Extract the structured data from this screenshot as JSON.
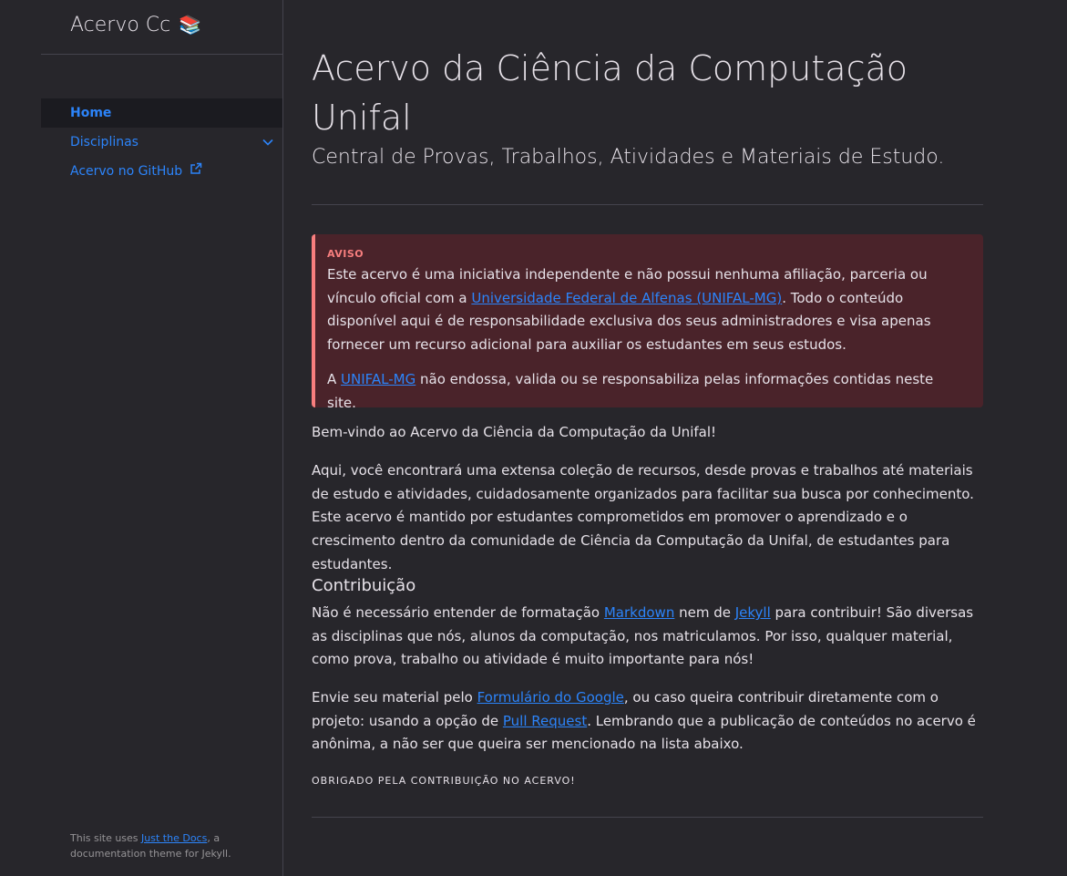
{
  "sidebar": {
    "site_title": "Acervo Cc",
    "site_title_emoji": "📚",
    "nav": {
      "home": "Home",
      "disciplinas": "Disciplinas",
      "github": "Acervo no GitHub"
    },
    "footer": {
      "before": "This site uses ",
      "link": "Just the Docs",
      "after": ", a documentation theme for Jekyll."
    }
  },
  "main": {
    "title": "Acervo da Ciência da Computação Unifal",
    "subtitle": "Central de Provas, Trabalhos, Atividades e Materiais de Estudo.",
    "warning": {
      "label": "AVISO",
      "p1_before": "Este acervo é uma iniciativa independente e não possui nenhuma afiliação, parceria ou vínculo oficial com a ",
      "p1_link": "Universidade Federal de Alfenas (UNIFAL-MG)",
      "p1_after": ". Todo o conteúdo disponível aqui é de responsabilidade exclusiva dos seus administradores e visa apenas fornecer um recurso adicional para auxiliar os estudantes em seus estudos.",
      "p2_before": "A ",
      "p2_link": "UNIFAL-MG",
      "p2_after": " não endossa, valida ou se responsabiliza pelas informações contidas neste site."
    },
    "welcome": "Bem-vindo ao Acervo da Ciência da Computação da Unifal!",
    "intro": "Aqui, você encontrará uma extensa coleção de recursos, desde provas e trabalhos até materiais de estudo e atividades, cuidadosamente organizados para facilitar sua busca por conhecimento. Este acervo é mantido por estudantes comprometidos em promover o aprendizado e o crescimento dentro da comunidade de Ciência da Computação da Unifal, de estudantes para estudantes.",
    "contrib_heading": "Contribuição",
    "contrib": {
      "t1": "Não é necessário entender de formatação ",
      "link_markdown": "Markdown",
      "t2": " nem de ",
      "link_jekyll": "Jekyll",
      "t3": " para contribuir! São diversas as disciplinas que nós, alunos da computação, nos matriculamos. Por isso, qualquer material, como prova, trabalho ou atividade é muito importante para nós!"
    },
    "envie": {
      "t1": "Envie seu material pelo ",
      "link_form": "Formulário do Google",
      "t2": ", ou caso queira contribuir diretamente com o projeto: usando a opção de ",
      "link_pr": "Pull Request",
      "t3": ". Lembrando que a publicação de conteúdos no acervo é anônima, a não ser que queira ser mencionado na lista abaixo."
    },
    "thanks": "OBRIGADO PELA CONTRIBUIÇÃO NO ACERVO!"
  },
  "colors": {
    "background": "#27262b",
    "link": "#2c84fa",
    "warning_bg": "#4a232a",
    "warning_accent": "#f77e7e"
  }
}
